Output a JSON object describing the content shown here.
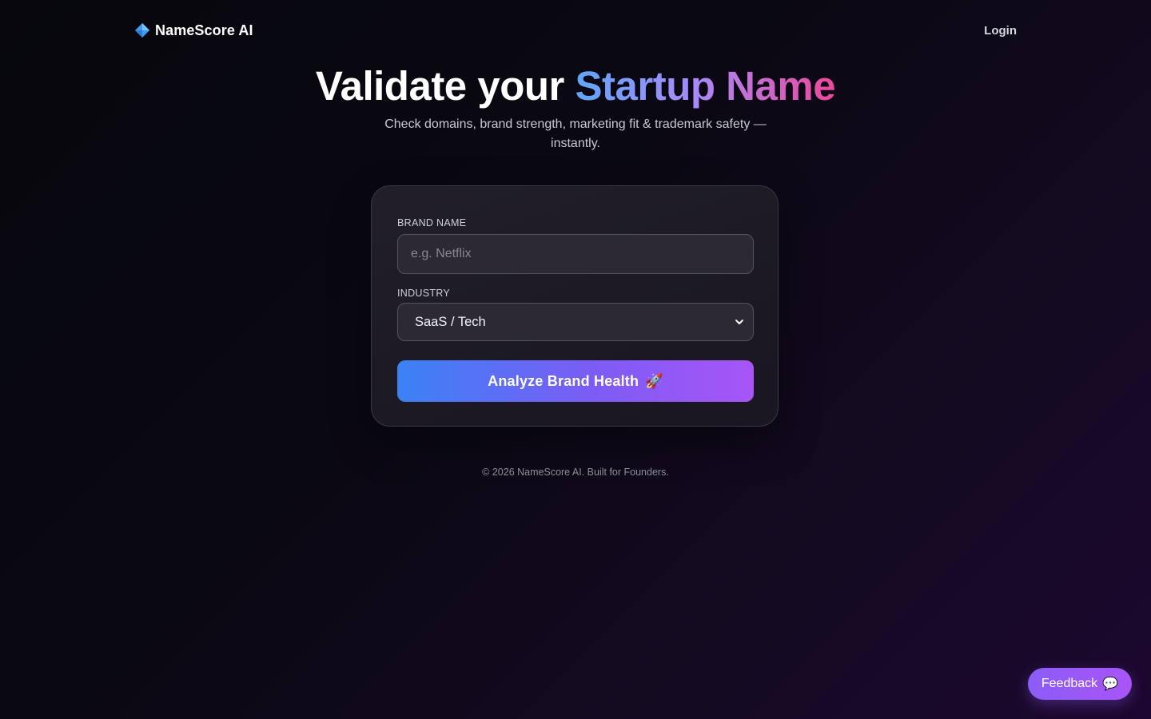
{
  "nav": {
    "brand": "NameScore AI",
    "brand_icon": "blue-diamond-icon",
    "login_label": "Login"
  },
  "hero": {
    "title_plain": "Validate your ",
    "title_highlight": "Startup Name",
    "subtitle": "Check domains, brand strength, marketing fit & trademark safety — instantly."
  },
  "form": {
    "brand_label": "BRAND NAME",
    "brand_placeholder": "e.g. Netflix",
    "brand_value": "",
    "industry_label": "INDUSTRY",
    "industry_selected": "SaaS / Tech",
    "submit_label": "Analyze Brand Health",
    "submit_icon": "🚀"
  },
  "footer": {
    "text": "© 2026 NameScore AI. Built for Founders."
  },
  "feedback": {
    "label": "Feedback",
    "icon": "💬"
  },
  "colors": {
    "accent_blue": "#3b82f6",
    "accent_purple": "#a855f7",
    "accent_pink": "#ec4899"
  }
}
